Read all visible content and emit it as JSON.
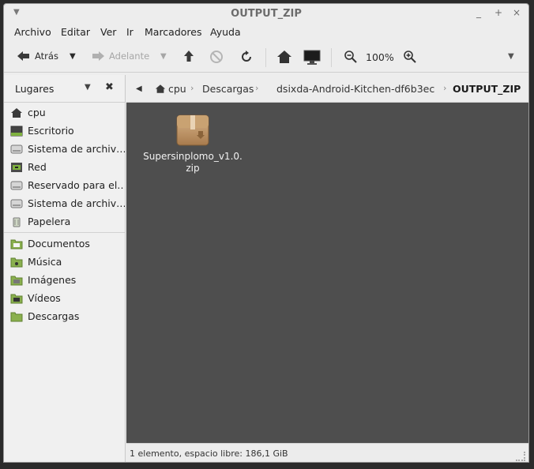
{
  "window": {
    "title": "OUTPUT_ZIP",
    "controls": [
      "_",
      "+",
      "×"
    ]
  },
  "menu": [
    {
      "label": "Archivo"
    },
    {
      "label": "Editar"
    },
    {
      "label": "Ver"
    },
    {
      "label": "Ir"
    },
    {
      "label": "Marcadores"
    },
    {
      "label": "Ayuda"
    }
  ],
  "toolbar": {
    "back_label": "Atrás",
    "forward_label": "Adelante",
    "zoom_level": "100%"
  },
  "sidebar": {
    "title": "Lugares",
    "places": [
      {
        "label": "cpu",
        "icon": "home-icon"
      },
      {
        "label": "Escritorio",
        "icon": "desktop-icon"
      },
      {
        "label": "Sistema de archiv…",
        "icon": "drive-icon"
      },
      {
        "label": "Red",
        "icon": "network-icon"
      },
      {
        "label": "Reservado para el…",
        "icon": "drive-icon"
      },
      {
        "label": "Sistema de archiv…",
        "icon": "drive-icon"
      },
      {
        "label": "Papelera",
        "icon": "trash-icon"
      }
    ],
    "bookmarks": [
      {
        "label": "Documentos",
        "icon": "folder-icon"
      },
      {
        "label": "Música",
        "icon": "folder-icon"
      },
      {
        "label": "Imágenes",
        "icon": "folder-icon"
      },
      {
        "label": "Vídeos",
        "icon": "folder-icon"
      },
      {
        "label": "Descargas",
        "icon": "folder-icon"
      }
    ]
  },
  "pathbar": {
    "crumbs": [
      "cpu",
      "Descargas",
      "dsixda-Android-Kitchen-df6b3ec",
      "OUTPUT_ZIP"
    ]
  },
  "files": [
    {
      "name_line1": "Supersinplomo_v1.0.",
      "name_line2": "zip",
      "icon": "zip-archive-icon"
    }
  ],
  "status": {
    "text": "1 elemento, espacio libre: 186,1 GiB"
  }
}
